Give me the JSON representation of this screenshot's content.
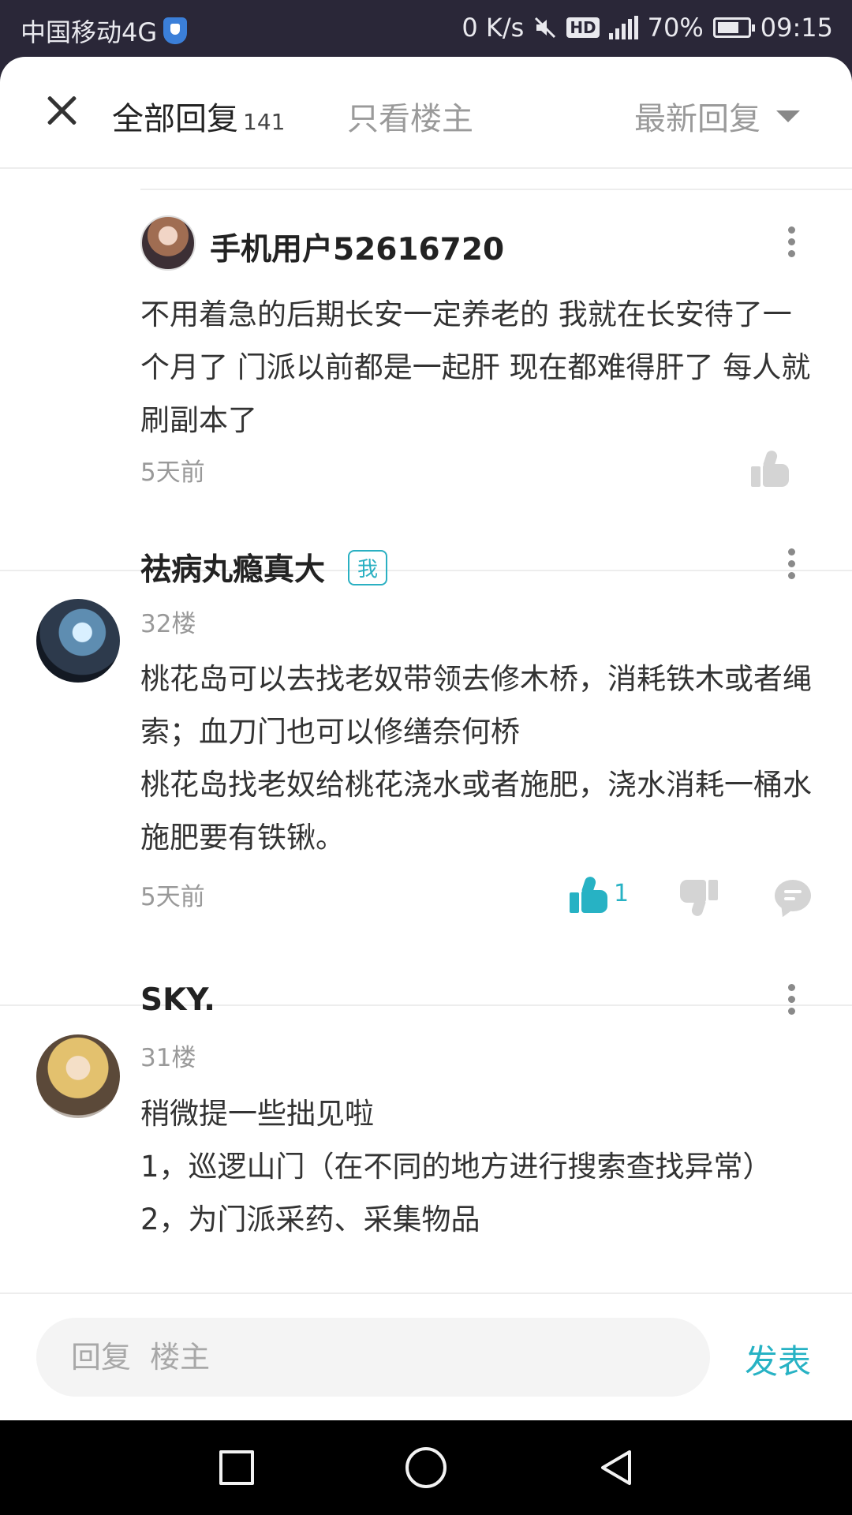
{
  "status_bar": {
    "carrier": "中国移动4G",
    "network_speed": "0 K/s",
    "hd_label": "HD",
    "battery": "70%",
    "time": "09:15"
  },
  "header": {
    "tab_all_label": "全部回复",
    "tab_all_count": "141",
    "tab_owner_label": "只看楼主",
    "sort_label": "最新回复"
  },
  "comments": [
    {
      "username": "手机用户52616720",
      "text": "不用着急的后期长安一定养老的 我就在长安待了一个月了 门派以前都是一起肝 现在都难得肝了 每人就刷副本了",
      "time": "5天前"
    },
    {
      "username": "祛病丸瘾真大",
      "badge": "我",
      "floor": "32楼",
      "text": "桃花岛可以去找老奴带领去修木桥，消耗铁木或者绳索；血刀门也可以修缮奈何桥\n桃花岛找老奴给桃花浇水或者施肥，浇水消耗一桶水施肥要有铁锹。",
      "time": "5天前",
      "likes": "1"
    },
    {
      "username": "SKY.",
      "floor": "31楼",
      "text": "稍微提一些拙见啦\n1，巡逻山门（在不同的地方进行搜索查找异常）\n2，为门派采药、采集物品"
    }
  ],
  "reply_bar": {
    "placeholder": "回复  楼主",
    "send_label": "发表"
  },
  "colors": {
    "accent": "#27b2c4",
    "status_bar_bg": "#2a2738"
  },
  "icons": [
    "close-icon",
    "chevron-down-icon",
    "more-icon",
    "like-icon",
    "dislike-icon",
    "comment-icon",
    "nav-recents-icon",
    "nav-home-icon",
    "nav-back-icon"
  ]
}
